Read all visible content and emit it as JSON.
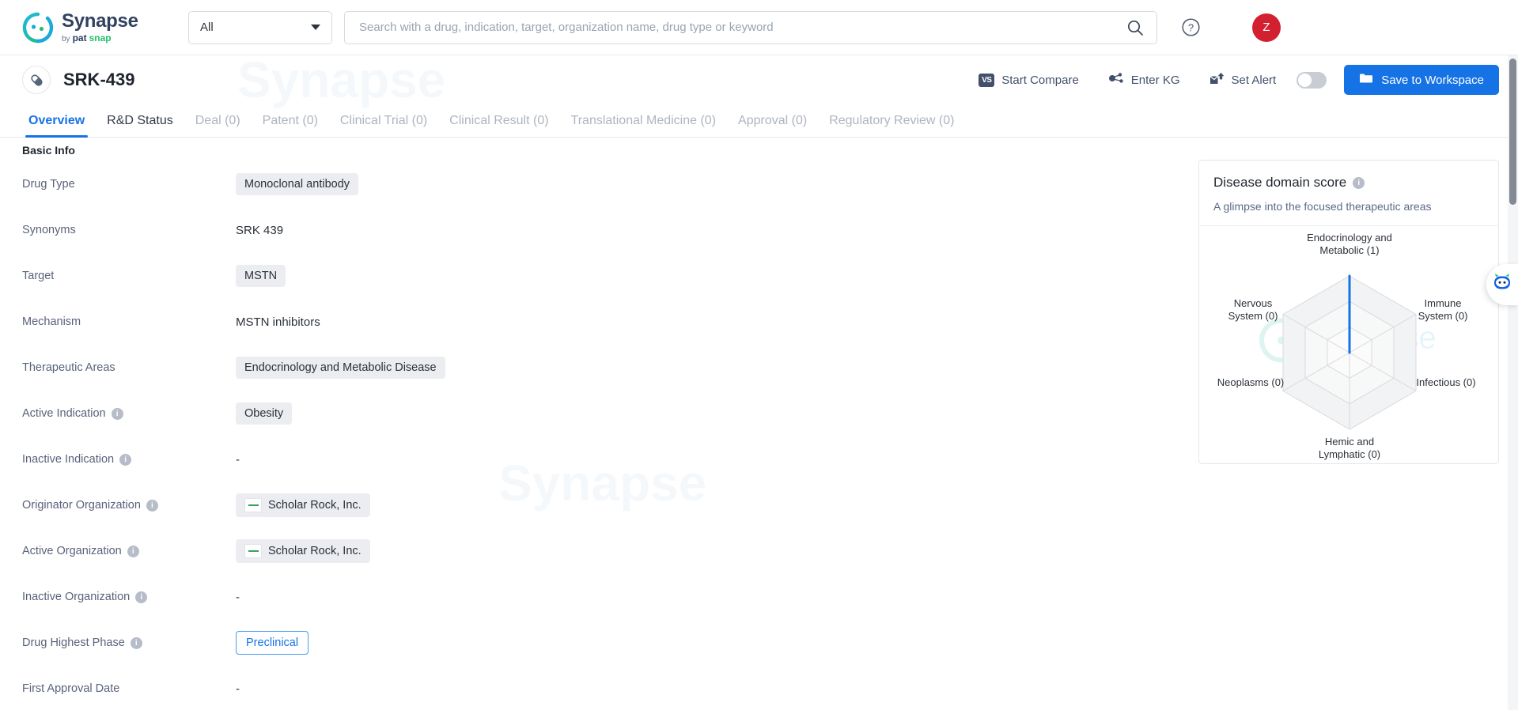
{
  "header": {
    "logo_title": "Synapse",
    "logo_by": "by",
    "logo_pat": "pat",
    "logo_snap": "snap",
    "category_value": "All",
    "search_placeholder": "Search with a drug, indication, target, organization name, drug type or keyword",
    "search_value": "",
    "help_icon": "help-circle-icon",
    "apps_icon": "grid-apps-icon",
    "avatar_initial": "Z",
    "avatar_color": "#d32030"
  },
  "titlebar": {
    "drug_icon": "capsule-pill-icon",
    "title": "SRK-439",
    "actions": [
      {
        "label": "Start Compare",
        "icon": "vs-icon"
      },
      {
        "label": "Enter KG",
        "icon": "knowledge-graph-icon"
      },
      {
        "label": "Set Alert",
        "icon": "alert-envelope-icon"
      }
    ],
    "toggle_state": "off",
    "save_label": "Save to Workspace",
    "save_icon": "folder-icon",
    "save_color": "#1673e6"
  },
  "tabs": [
    {
      "label": "Overview",
      "state": "active"
    },
    {
      "label": "R&D Status",
      "state": "dark"
    },
    {
      "label": "Deal (0)",
      "state": "muted"
    },
    {
      "label": "Patent (0)",
      "state": "muted"
    },
    {
      "label": "Clinical Trial (0)",
      "state": "muted"
    },
    {
      "label": "Clinical Result (0)",
      "state": "muted"
    },
    {
      "label": "Translational Medicine (0)",
      "state": "muted"
    },
    {
      "label": "Approval (0)",
      "state": "muted"
    },
    {
      "label": "Regulatory Review (0)",
      "state": "muted"
    }
  ],
  "basic_info": {
    "section_title": "Basic Info",
    "rows": [
      {
        "label": "Drug Type",
        "info": false,
        "type": "chip",
        "value": "Monoclonal antibody"
      },
      {
        "label": "Synonyms",
        "info": false,
        "type": "text",
        "value": "SRK 439"
      },
      {
        "label": "Target",
        "info": false,
        "type": "chip",
        "value": "MSTN"
      },
      {
        "label": "Mechanism",
        "info": false,
        "type": "text",
        "value": "MSTN inhibitors"
      },
      {
        "label": "Therapeutic Areas",
        "info": false,
        "type": "chip",
        "value": "Endocrinology and Metabolic Disease"
      },
      {
        "label": "Active Indication",
        "info": true,
        "type": "chip",
        "value": "Obesity"
      },
      {
        "label": "Inactive Indication",
        "info": true,
        "type": "text",
        "value": "-"
      },
      {
        "label": "Originator Organization",
        "info": true,
        "type": "org",
        "value": "Scholar Rock, Inc."
      },
      {
        "label": "Active Organization",
        "info": true,
        "type": "org",
        "value": "Scholar Rock, Inc."
      },
      {
        "label": "Inactive Organization",
        "info": true,
        "type": "text",
        "value": "-"
      },
      {
        "label": "Drug Highest Phase",
        "info": true,
        "type": "outline",
        "value": "Preclinical"
      },
      {
        "label": "First Approval Date",
        "info": false,
        "type": "text",
        "value": "-"
      }
    ]
  },
  "disease_panel": {
    "title": "Disease domain score",
    "subtitle": "A glimpse into the focused therapeutic areas"
  },
  "chart_data": {
    "type": "radar",
    "title": "Disease domain score",
    "subtitle": "A glimpse into the focused therapeutic areas",
    "categories": [
      "Endocrinology and\nMetabolic (1)",
      "Immune\nSystem (0)",
      "Infectious (0)",
      "Hemic and\nLymphatic (0)",
      "Neoplasms (0)",
      "Nervous\nSystem (0)"
    ],
    "category_names": [
      "Endocrinology and Metabolic",
      "Immune System",
      "Infectious",
      "Hemic and Lymphatic",
      "Neoplasms",
      "Nervous System"
    ],
    "values": [
      1,
      0,
      0,
      0,
      0,
      0
    ],
    "rmax": 1,
    "rings": 3,
    "grid": true,
    "legend": "none",
    "series_color": "#1673e6",
    "grid_color": "#d8dade"
  },
  "bot_widget": {
    "icon": "robot-assistant-icon"
  },
  "scrollbar": {
    "present": true
  }
}
